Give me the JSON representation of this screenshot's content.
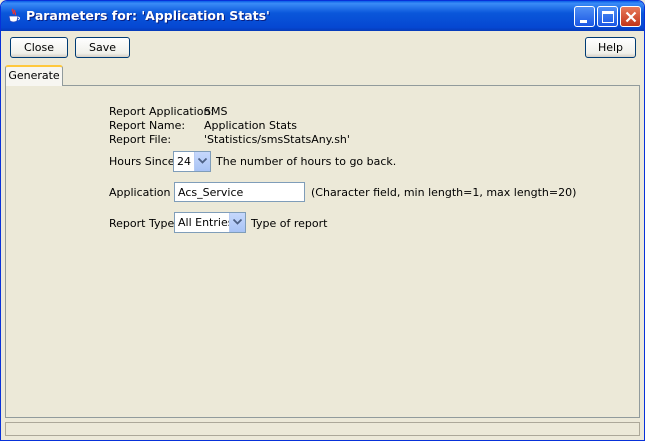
{
  "window": {
    "title": "Parameters for: 'Application Stats'"
  },
  "toolbar": {
    "close_label": "Close",
    "save_label": "Save",
    "help_label": "Help"
  },
  "tabs": [
    {
      "label": "Generate",
      "active": true
    }
  ],
  "report_info": {
    "application_label": "Report Application:",
    "application_value": "SMS",
    "name_label": "Report Name:",
    "name_value": "Application Stats",
    "file_label": "Report File:",
    "file_value": "'Statistics/smsStatsAny.sh'"
  },
  "params": {
    "hours_since": {
      "label": "Hours Since",
      "value": "24",
      "description": "The number of hours to go back."
    },
    "application": {
      "label": "Application",
      "value": "Acs_Service",
      "description": "(Character field, min length=1, max length=20)"
    },
    "report_type": {
      "label": "Report Type",
      "value": "All Entries",
      "description": "Type of report"
    }
  },
  "icons": {
    "app": "java-cup-icon",
    "minimize": "minimize-icon",
    "maximize": "maximize-icon",
    "close": "close-icon",
    "dropdown": "chevron-down-icon"
  },
  "colors": {
    "titlebar": "#0A57DA",
    "background": "#ECE9D8",
    "tab_accent": "#FFC83C",
    "close_button": "#C2351A"
  }
}
